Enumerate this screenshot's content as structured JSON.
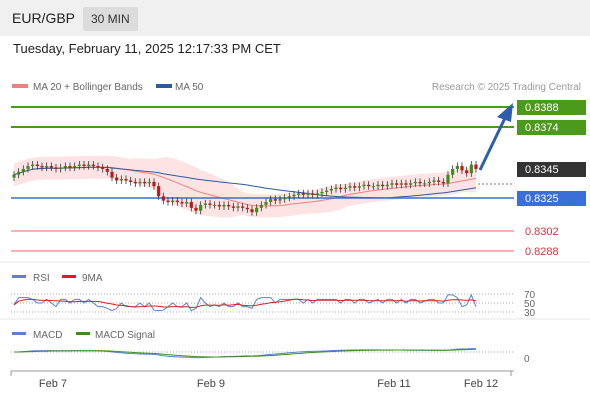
{
  "header": {
    "symbol": "EUR/GBP",
    "timeframe": "30 MIN"
  },
  "datetime": "Tuesday, February 11, 2025 12:17:33 PM CET",
  "legend": {
    "ma20": "MA 20 + Bollinger Bands",
    "ma50": "MA 50",
    "credit": "Research © 2025 Trading Central"
  },
  "colors": {
    "resistance": "#4c9a1c",
    "support": "#f09aa0",
    "pivot": "#3a6fd8",
    "current_bg": "#333333",
    "arrow": "#2d5fa8",
    "ma20": "#f08080",
    "ma50": "#2d5a9e",
    "rsi": "#5a7fd8",
    "rsi_ma": "#d92020",
    "macd": "#5a7fd8",
    "macd_signal": "#3d8f1a"
  },
  "levels": {
    "r2": "0.8388",
    "r1": "0.8374",
    "current": "0.8345",
    "pivot": "0.8325",
    "s1": "0.8302",
    "s2": "0.8288"
  },
  "rsi": {
    "label": "RSI",
    "ma_label": "9MA",
    "ticks": [
      "70",
      "50",
      "30"
    ]
  },
  "macd": {
    "label": "MACD",
    "signal_label": "MACD Signal",
    "tick": "0"
  },
  "chart_data": {
    "type": "candlestick",
    "x_ticks": [
      "Feb 7",
      "Feb 9",
      "Feb 11",
      "Feb 12"
    ],
    "key_levels": [
      0.8388,
      0.8374,
      0.8345,
      0.8325,
      0.8302,
      0.8288
    ],
    "close": [
      0.8341,
      0.8343,
      0.8345,
      0.8347,
      0.8348,
      0.8347,
      0.8346,
      0.8347,
      0.8346,
      0.8345,
      0.8346,
      0.8347,
      0.8346,
      0.8347,
      0.8348,
      0.8347,
      0.8348,
      0.8347,
      0.8346,
      0.8345,
      0.8343,
      0.8339,
      0.8337,
      0.8338,
      0.8337,
      0.8336,
      0.8335,
      0.8336,
      0.8335,
      0.8336,
      0.8333,
      0.8326,
      0.8323,
      0.8322,
      0.8323,
      0.8322,
      0.8321,
      0.8322,
      0.8318,
      0.8316,
      0.832,
      0.8321,
      0.832,
      0.832,
      0.8319,
      0.832,
      0.8319,
      0.8318,
      0.8319,
      0.8318,
      0.8317,
      0.8315,
      0.8318,
      0.832,
      0.8322,
      0.8324,
      0.8323,
      0.8324,
      0.8325,
      0.8326,
      0.8327,
      0.8328,
      0.8327,
      0.8328,
      0.8327,
      0.8328,
      0.8329,
      0.833,
      0.8331,
      0.8332,
      0.8331,
      0.8332,
      0.8333,
      0.8332,
      0.8333,
      0.8334,
      0.8333,
      0.8333,
      0.8334,
      0.8333,
      0.8334,
      0.8335,
      0.8334,
      0.8335,
      0.8334,
      0.8335,
      0.8336,
      0.8335,
      0.8335,
      0.8336,
      0.8337,
      0.8336,
      0.8335,
      0.8341,
      0.8345,
      0.8347,
      0.8344,
      0.8342,
      0.8348,
      0.8345
    ],
    "rsi_ylim": [
      30,
      70
    ]
  }
}
